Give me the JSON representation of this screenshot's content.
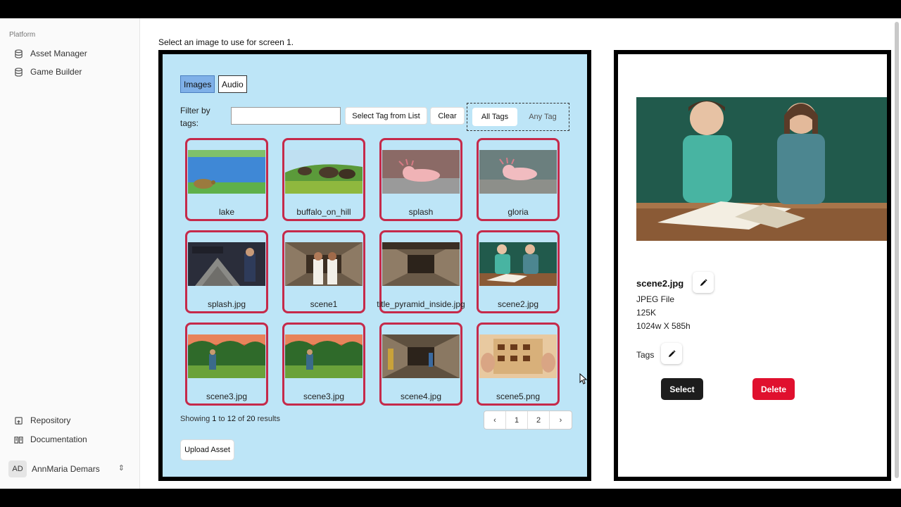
{
  "sidebar": {
    "heading": "Platform",
    "items": [
      {
        "label": "Asset Manager",
        "icon": "database-icon"
      },
      {
        "label": "Game Builder",
        "icon": "database-icon"
      }
    ],
    "bottom_items": [
      {
        "label": "Repository",
        "icon": "repository-icon"
      },
      {
        "label": "Documentation",
        "icon": "book-icon"
      }
    ],
    "user": {
      "initials": "AD",
      "name": "AnnMaria Demars"
    }
  },
  "instruction": "Select an image to use for screen 1.",
  "tabs": {
    "images": "Images",
    "audio": "Audio"
  },
  "filter": {
    "label": "Filter by tags:",
    "input_value": "",
    "select_tag_label": "Select Tag from List",
    "clear_label": "Clear",
    "all_tags_label": "All Tags",
    "any_tag_label": "Any Tag"
  },
  "assets": [
    {
      "label": "lake",
      "thumb": "lake"
    },
    {
      "label": "buffalo_on_hill",
      "thumb": "buffalo"
    },
    {
      "label": "splash",
      "thumb": "axolotl"
    },
    {
      "label": "gloria",
      "thumb": "axolotl2"
    },
    {
      "label": "splash.jpg",
      "thumb": "masks"
    },
    {
      "label": "scene1",
      "thumb": "hall_people"
    },
    {
      "label": "title_pyramid_inside.jpg",
      "thumb": "hall"
    },
    {
      "label": "scene2.jpg",
      "thumb": "classroom"
    },
    {
      "label": "scene3.jpg",
      "thumb": "jungle"
    },
    {
      "label": "scene3.jpg",
      "thumb": "jungle"
    },
    {
      "label": "scene4.jpg",
      "thumb": "hall_figures"
    },
    {
      "label": "scene5.png",
      "thumb": "map"
    }
  ],
  "pagination": {
    "showing_prefix": "Showing",
    "from": "1",
    "to_word": "to",
    "to": "12",
    "of_word": "of",
    "total": "20",
    "results_word": "results",
    "prev": "‹",
    "pages": [
      "1",
      "2"
    ],
    "next": "›"
  },
  "upload_label": "Upload Asset",
  "details": {
    "filename": "scene2.jpg",
    "filetype": "JPEG File",
    "filesize": "125K",
    "dimensions": "1024w X 585h",
    "tags_label": "Tags",
    "select_label": "Select",
    "delete_label": "Delete"
  },
  "colors": {
    "panel_bg": "#bde5f7",
    "card_border": "#c52a4a",
    "tab_active": "#7fb0e8",
    "delete": "#e0102e",
    "select": "#1d1d1d"
  }
}
